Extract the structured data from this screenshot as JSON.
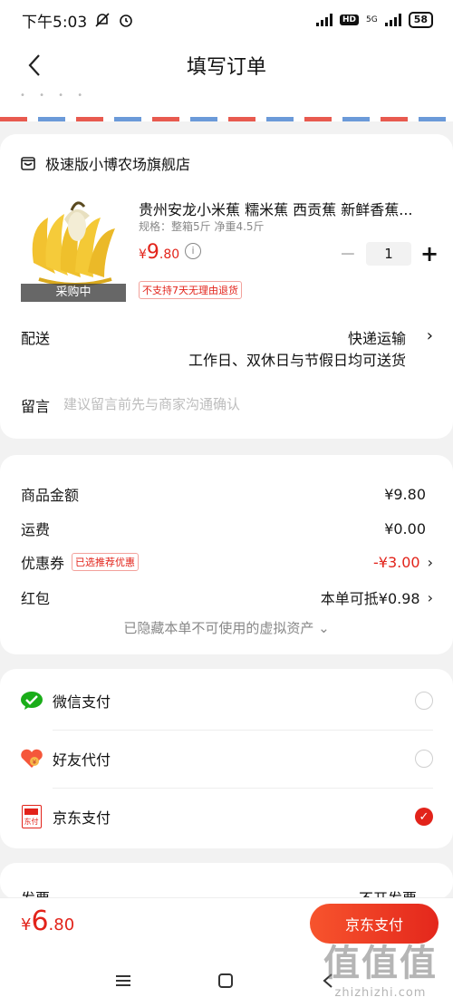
{
  "status_bar": {
    "time": "下午5:03",
    "network_5g": "5G",
    "hd": "HD",
    "battery": "58"
  },
  "nav": {
    "title": "填写订单"
  },
  "store": {
    "name": "极速版小博农场旗舰店",
    "product": {
      "title": "贵州安龙小米蕉 糯米蕉 西贡蕉 新鲜香蕉...",
      "spec": "规格：整箱5斤 净重4.5斤",
      "price_currency": "¥",
      "price_int": "9",
      "price_dec": ".80",
      "info_icon": "i",
      "buying_tag": "采购中",
      "quantity": "1",
      "minus": "−",
      "plus": "+",
      "no_return_tag": "不支持7天无理由退货"
    },
    "delivery": {
      "label": "配送",
      "method": "快递运输",
      "detail": "工作日、双休日与节假日均可送货"
    },
    "remark": {
      "label": "留言",
      "placeholder": "建议留言前先与商家沟通确认"
    }
  },
  "amounts": {
    "goods": {
      "label": "商品金额",
      "value": "¥9.80"
    },
    "shipping": {
      "label": "运费",
      "value": "¥0.00"
    },
    "coupon": {
      "label": "优惠券",
      "tag": "已选推荐优惠",
      "value": "-¥3.00"
    },
    "red_packet": {
      "label": "红包",
      "value": "本单可抵¥0.98"
    },
    "hidden_assets": "已隐藏本单不可使用的虚拟资产 ⌄"
  },
  "payment": {
    "methods": [
      {
        "label": "微信支付",
        "icon": "wechat-pay-icon",
        "checked": false
      },
      {
        "label": "好友代付",
        "icon": "friend-pay-icon",
        "checked": false
      },
      {
        "label": "京东支付",
        "icon": "jd-pay-icon",
        "checked": true
      }
    ],
    "jd_icon_text": "东付"
  },
  "partial": {
    "left": "发票",
    "right": "不开发票"
  },
  "bottom": {
    "total_currency": "¥",
    "total_int": "6",
    "total_dec": ".80",
    "pay_button": "京东支付"
  },
  "watermark": {
    "big": "值值值",
    "small": "zhizhizhi.com"
  },
  "colors": {
    "accent": "#e2231a",
    "wechat_green": "#1aad19"
  }
}
